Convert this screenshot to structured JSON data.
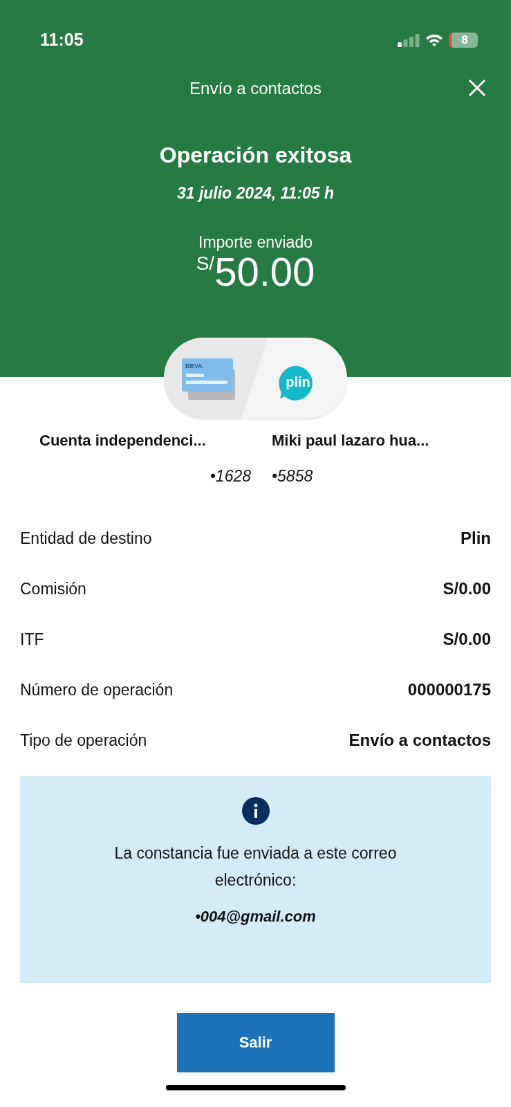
{
  "status_bar": {
    "time": "11:05",
    "battery": "8"
  },
  "header": {
    "title": "Envío a contactos",
    "heading": "Operación exitosa",
    "date": "31 julio 2024, 11:05 h",
    "amount_label": "Importe enviado",
    "currency": "S/",
    "amount": "50.00"
  },
  "transfer": {
    "origin_logo": "BBVA",
    "destination_logo": "plin",
    "origin": {
      "name": "Cuenta independenci...",
      "account": "•1628"
    },
    "destination": {
      "name": "Miki paul lazaro hua...",
      "account": "•5858"
    }
  },
  "details": [
    {
      "label": "Entidad de destino",
      "value": "Plin"
    },
    {
      "label": "Comisión",
      "value": "S/0.00"
    },
    {
      "label": "ITF",
      "value": "S/0.00"
    },
    {
      "label": "Número de operación",
      "value": "000000175"
    },
    {
      "label": "Tipo de operación",
      "value": "Envío a contactos"
    }
  ],
  "notice": {
    "text": "La constancia fue enviada a este correo electrónico:",
    "email": "•004@gmail.com"
  },
  "buttons": [
    "Salir"
  ]
}
